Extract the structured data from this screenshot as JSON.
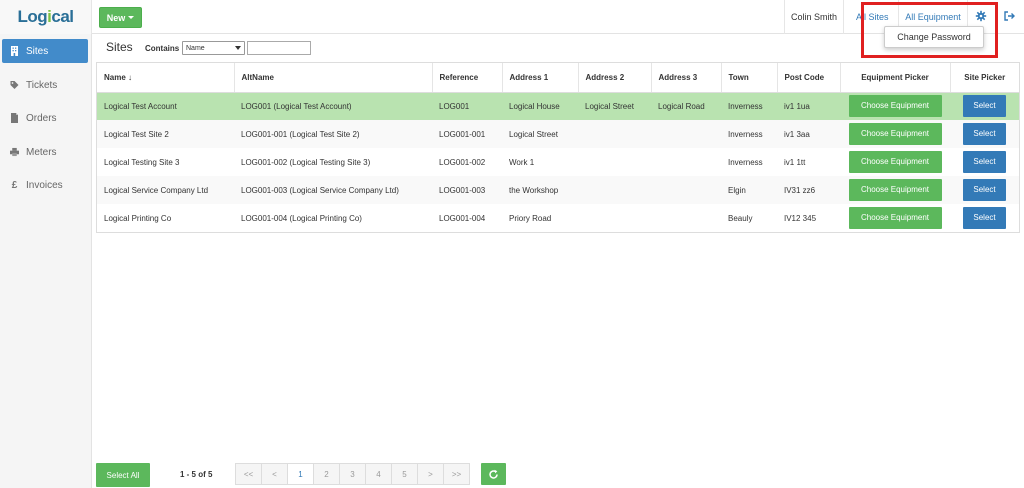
{
  "logo": {
    "text_prefix": "Log",
    "text_o": "i",
    "text_suffix": "cal",
    "tagline": ""
  },
  "header": {
    "new_label": "New",
    "user_name": "Colin Smith",
    "all_sites": "All Sites",
    "all_equipment": "All Equipment",
    "dropdown_item": "Change Password"
  },
  "sidebar": {
    "items": [
      {
        "label": "Sites",
        "icon": "building-icon",
        "active": true
      },
      {
        "label": "Tickets",
        "icon": "tag-icon",
        "active": false
      },
      {
        "label": "Orders",
        "icon": "document-icon",
        "active": false
      },
      {
        "label": "Meters",
        "icon": "printer-icon",
        "active": false
      },
      {
        "label": "Invoices",
        "icon": "pound-icon",
        "active": false
      }
    ]
  },
  "page": {
    "title": "Sites",
    "contains_label": "Contains",
    "filter_value": "Name",
    "filter_input": ""
  },
  "table": {
    "headers": [
      "Name",
      "AltName",
      "Reference",
      "Address 1",
      "Address 2",
      "Address 3",
      "Town",
      "Post Code",
      "Equipment Picker",
      "Site Picker"
    ],
    "rows": [
      [
        "Logical Test Account",
        "LOG001 (Logical Test Account)",
        "LOG001",
        "Logical House",
        "Logical Street",
        "Logical Road",
        "Inverness",
        "iv1 1ua"
      ],
      [
        "Logical Test Site 2",
        "LOG001-001 (Logical Test Site 2)",
        "LOG001-001",
        "Logical Street",
        "",
        "",
        "Inverness",
        "iv1 3aa"
      ],
      [
        "Logical Testing Site 3",
        "LOG001-002 (Logical Testing Site 3)",
        "LOG001-002",
        "Work 1",
        "",
        "",
        "Inverness",
        "iv1 1tt"
      ],
      [
        "Logical Service Company Ltd",
        "LOG001-003 (Logical Service Company Ltd)",
        "LOG001-003",
        "the Workshop",
        "",
        "",
        "Elgin",
        "IV31 zz6"
      ],
      [
        "Logical Printing Co",
        "LOG001-004 (Logical Printing Co)",
        "LOG001-004",
        "Priory Road",
        "",
        "",
        "Beauly",
        "IV12 345"
      ]
    ],
    "choose_label": "Choose Equipment",
    "select_label": "Select",
    "selected_row": 0
  },
  "footer": {
    "select_all": "Select All",
    "range": "1 - 5 of 5",
    "pages": [
      "<<",
      "<",
      "1",
      "2",
      "3",
      "4",
      "5",
      ">",
      ">>"
    ],
    "current_page": "1"
  },
  "colors": {
    "primary_green": "#5cb85c",
    "primary_blue": "#337ab7",
    "sidebar_active": "#428bca",
    "selected_row": "#b9e3b0",
    "highlight_red": "#e02020"
  }
}
